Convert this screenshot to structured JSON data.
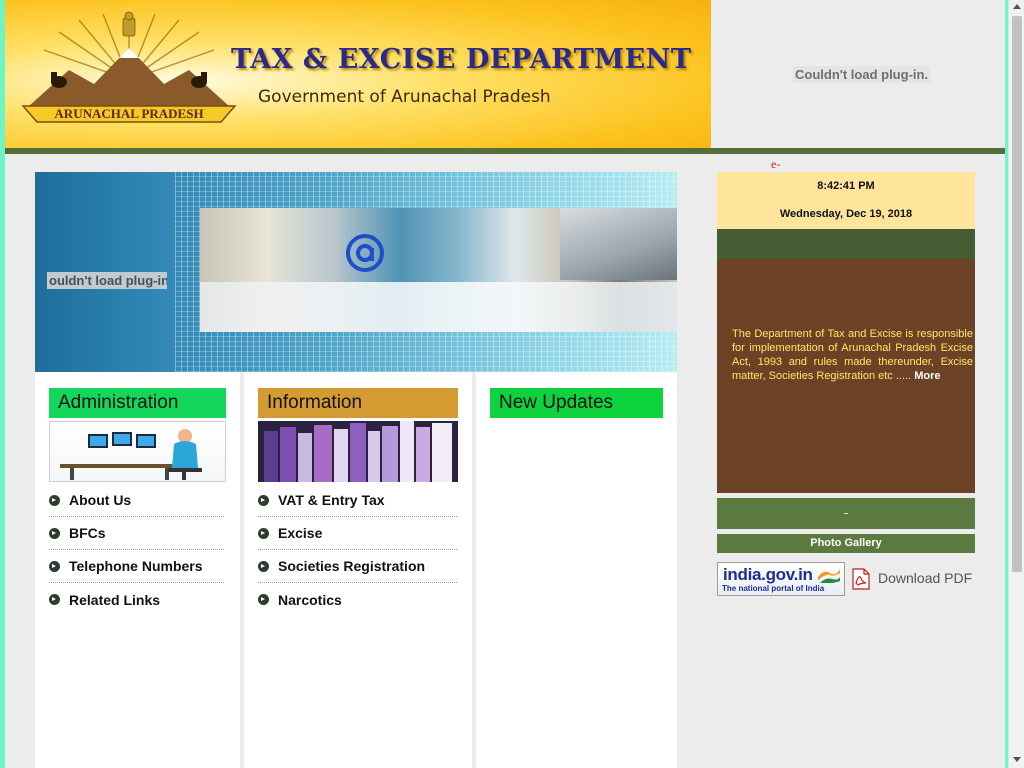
{
  "colors": {
    "accent_green": "#13d65a",
    "info_orange": "#d39b32",
    "olive": "#546e3b",
    "about_bg": "#6b4226",
    "about_text": "#ffe766",
    "clock_bg": "#ffe49b",
    "stripe": "#6ff5c4"
  },
  "header": {
    "emblem_label": "ARUNACHAL PRADESH",
    "title": "TAX & EXCISE DEPARTMENT",
    "subtitle": "Government of Arunachal Pradesh",
    "plugin_message": "Couldn't load plug-in."
  },
  "top_link": "e-",
  "hero": {
    "plugin_message": "ouldn't load plug-in"
  },
  "panels": {
    "administration": {
      "title": "Administration",
      "links": [
        "About Us",
        "BFCs",
        "Telephone Numbers",
        "Related Links"
      ]
    },
    "information": {
      "title": "Information",
      "links": [
        "VAT & Entry Tax",
        "Excise",
        "Societies Registration",
        "Narcotics"
      ]
    },
    "updates": {
      "title": "New Updates"
    }
  },
  "sidebar": {
    "time": "8:42:41 PM",
    "date": "Wednesday, Dec 19, 2018",
    "about_text": "The Department of Tax and Excise is responsible for implementation of Arunachal Pradesh Excise Act, 1993 and rules made thereunder, Excise matter, Societies Registration etc .....",
    "more_label": "More",
    "dash_text": "-",
    "gallery_label": "Photo Gallery",
    "india_logo_main": "india.gov.in",
    "india_logo_sub": "The national portal of India",
    "download_label": "Download PDF"
  },
  "icons": {
    "bullet": "circle-arrow-icon",
    "pdf": "pdf-icon",
    "flag": "india-flag-icon",
    "at": "at-sign-icon",
    "emblem": "state-emblem-icon"
  }
}
